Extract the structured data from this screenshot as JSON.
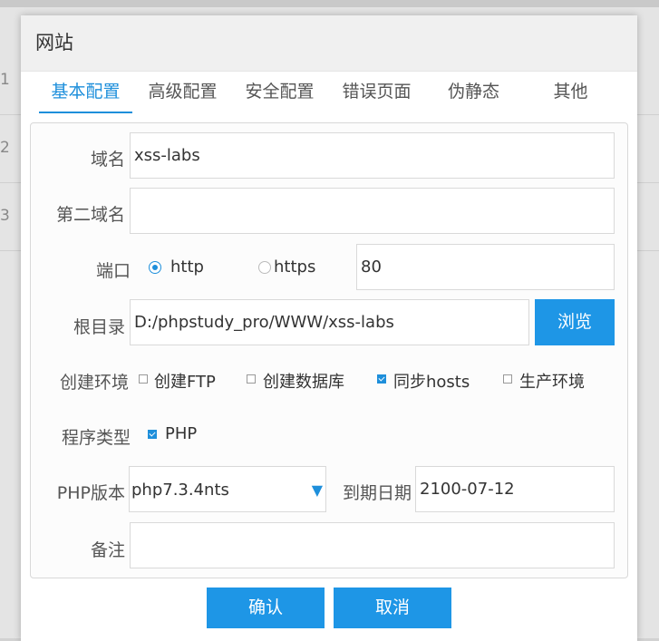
{
  "background": {
    "row_numbers": [
      "1",
      "2",
      "3"
    ]
  },
  "modal": {
    "title": "网站",
    "tabs": [
      "基本配置",
      "高级配置",
      "安全配置",
      "错误页面",
      "伪静态",
      "其他"
    ],
    "active_tab": "基本配置"
  },
  "form": {
    "domain": {
      "label": "域名",
      "value": "xss-labs"
    },
    "second_domain": {
      "label": "第二域名",
      "value": ""
    },
    "port": {
      "label": "端口",
      "options": [
        "http",
        "https"
      ],
      "selected": "http",
      "value": "80"
    },
    "root_dir": {
      "label": "根目录",
      "value": "D:/phpstudy_pro/WWW/xss-labs",
      "browse_label": "浏览"
    },
    "create_env": {
      "label": "创建环境",
      "options": [
        {
          "label": "创建FTP",
          "checked": false
        },
        {
          "label": "创建数据库",
          "checked": false
        },
        {
          "label": "同步hosts",
          "checked": true
        },
        {
          "label": "生产环境",
          "checked": false
        }
      ]
    },
    "program_type": {
      "label": "程序类型",
      "options": [
        {
          "label": "PHP",
          "checked": true
        }
      ]
    },
    "php_version": {
      "label": "PHP版本",
      "value": "php7.3.4nts"
    },
    "expire_date": {
      "label": "到期日期",
      "value": "2100-07-12"
    },
    "remark": {
      "label": "备注",
      "value": ""
    }
  },
  "footer": {
    "confirm_label": "确认",
    "cancel_label": "取消"
  },
  "colors": {
    "accent": "#1e8fdb",
    "button": "#1e96e6"
  }
}
